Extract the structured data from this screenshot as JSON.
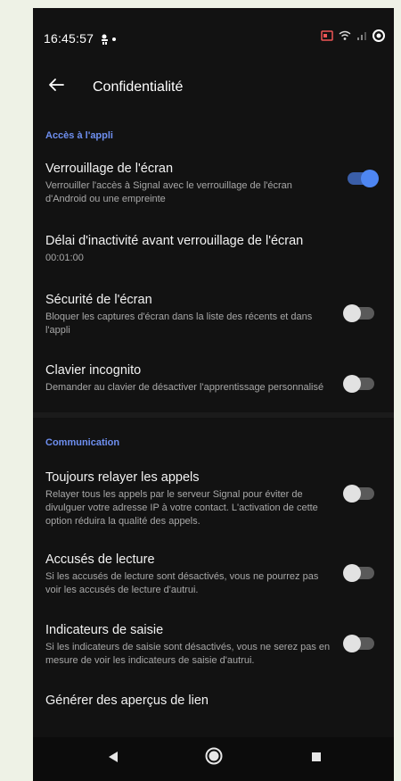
{
  "status_bar": {
    "time": "16:45:57"
  },
  "app_bar": {
    "title": "Confidentialité"
  },
  "sections": {
    "app_access": {
      "header": "Accès à l'appli",
      "screen_lock": {
        "title": "Verrouillage de l'écran",
        "subtitle": "Verrouiller l'accès à Signal avec le verrouillage de l'écran d'Android ou une empreinte",
        "enabled": true
      },
      "inactivity_timeout": {
        "title": "Délai d'inactivité avant verrouillage de l'écran",
        "subtitle": "00:01:00"
      },
      "screen_security": {
        "title": "Sécurité de l'écran",
        "subtitle": "Bloquer les captures d'écran dans la liste des récents et dans l'appli",
        "enabled": false
      },
      "incognito_keyboard": {
        "title": "Clavier incognito",
        "subtitle": "Demander au clavier de désactiver l'apprentissage personnalisé",
        "enabled": false
      }
    },
    "communication": {
      "header": "Communication",
      "relay_calls": {
        "title": "Toujours relayer les appels",
        "subtitle": "Relayer tous les appels par le serveur Signal pour éviter de divulguer votre adresse IP à votre contact. L'activation de cette option réduira la qualité des appels.",
        "enabled": false
      },
      "read_receipts": {
        "title": "Accusés de lecture",
        "subtitle": "Si les accusés de lecture sont désactivés, vous ne pourrez pas voir les accusés de lecture d'autrui.",
        "enabled": false
      },
      "typing_indicators": {
        "title": "Indicateurs de saisie",
        "subtitle": "Si les indicateurs de saisie sont désactivés, vous ne serez pas en mesure de voir les indicateurs de saisie d'autrui.",
        "enabled": false
      },
      "link_previews": {
        "title": "Générer des aperçus de lien"
      }
    }
  },
  "icons": {
    "back": "arrow-left-icon",
    "nav_back": "triangle-back-icon",
    "nav_home": "circle-home-icon",
    "nav_recents": "square-recents-icon"
  },
  "colors": {
    "background": "#121212",
    "accent": "#4e86f2",
    "section_header": "#6e8ff0"
  }
}
